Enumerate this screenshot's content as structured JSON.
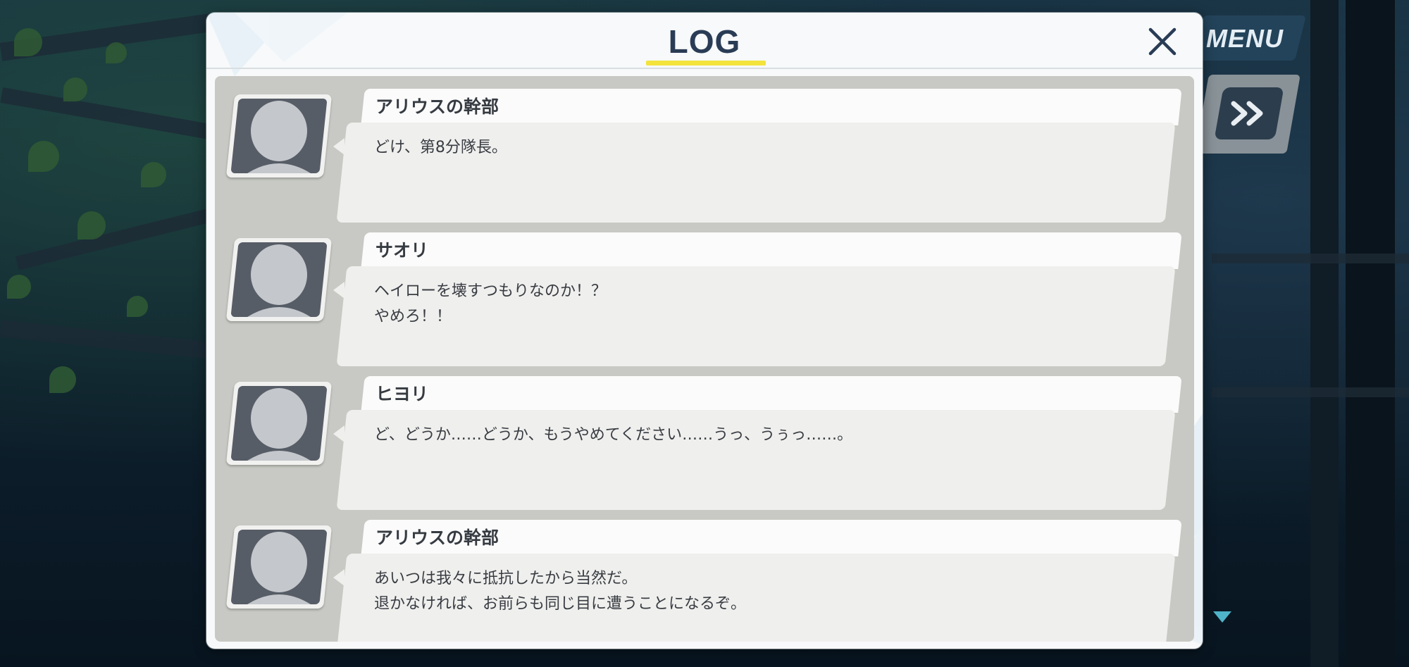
{
  "menu": {
    "label": "MENU",
    "fast_forward_icon": "double-chevron-right-icon"
  },
  "dialog": {
    "title": "LOG",
    "close_icon": "close-icon",
    "accent_color": "#f3e33c"
  },
  "entries": [
    {
      "speaker": "アリウスの幹部",
      "text": "どけ、第8分隊長。"
    },
    {
      "speaker": "サオリ",
      "text": "ヘイローを壊すつもりなのか！？\nやめろ！！"
    },
    {
      "speaker": "ヒヨリ",
      "text": "ど、どうか……どうか、もうやめてください……うっ、うぅっ……。"
    },
    {
      "speaker": "アリウスの幹部",
      "text": "あいつは我々に抵抗したから当然だ。\n退かなければ、お前らも同じ目に遭うことになるぞ。"
    }
  ],
  "scroll_indicator_icon": "triangle-down-icon"
}
